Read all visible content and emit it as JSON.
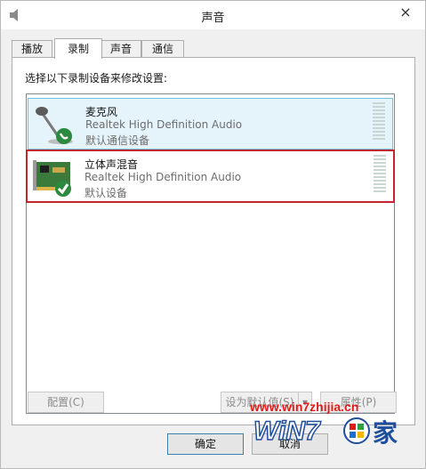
{
  "window": {
    "title": "声音",
    "close_glyph": "×"
  },
  "tabs": [
    {
      "label": "播放",
      "active": false
    },
    {
      "label": "录制",
      "active": true
    },
    {
      "label": "声音",
      "active": false
    },
    {
      "label": "通信",
      "active": false
    }
  ],
  "panel": {
    "instruction": "选择以下录制设备来修改设置:"
  },
  "devices": [
    {
      "name": "麦克风",
      "driver": "Realtek High Definition Audio",
      "status": "默认通信设备",
      "icon": "microphone-icon",
      "badge": "phone-badge-icon",
      "selected": true
    },
    {
      "name": "立体声混音",
      "driver": "Realtek High Definition Audio",
      "status": "默认设备",
      "icon": "sound-card-icon",
      "badge": "check-badge-icon",
      "selected": false,
      "highlight_color": "#c0272d"
    }
  ],
  "buttons": {
    "configure": "配置(C)",
    "set_default": "设为默认值(S)",
    "properties": "属性(P)",
    "ok": "确定",
    "cancel": "取消"
  },
  "watermark": {
    "url": "www.win7zhijia.cn",
    "logo_text": "WiN7",
    "logo_suffix": "家"
  },
  "colors": {
    "selection_bg": "#e5f3fb",
    "selection_border": "#70c0e7",
    "highlight_box": "#c0272d",
    "watermark_red": "#e01b1b",
    "watermark_blue": "#1f4e9c"
  }
}
